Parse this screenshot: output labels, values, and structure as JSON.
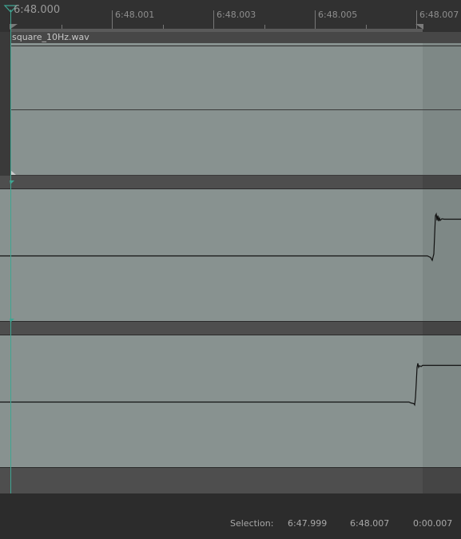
{
  "ruler": {
    "labels": [
      "6:48.000",
      "6:48.001",
      "6:48.003",
      "6:48.005",
      "6:48.007"
    ]
  },
  "clip": {
    "name": "square_10Hz.wav"
  },
  "status": {
    "selection_label": "Selection:",
    "start": "6:47.999",
    "end": "6:48.007",
    "length": "0:00.007"
  },
  "colors": {
    "waveform_bg": "#889290",
    "selection_overlay": "#7e8886",
    "playhead": "#3fa592",
    "panel": "#2c2c2c"
  },
  "icons": [
    "playhead-marker-icon",
    "scroll-handle-icon"
  ]
}
